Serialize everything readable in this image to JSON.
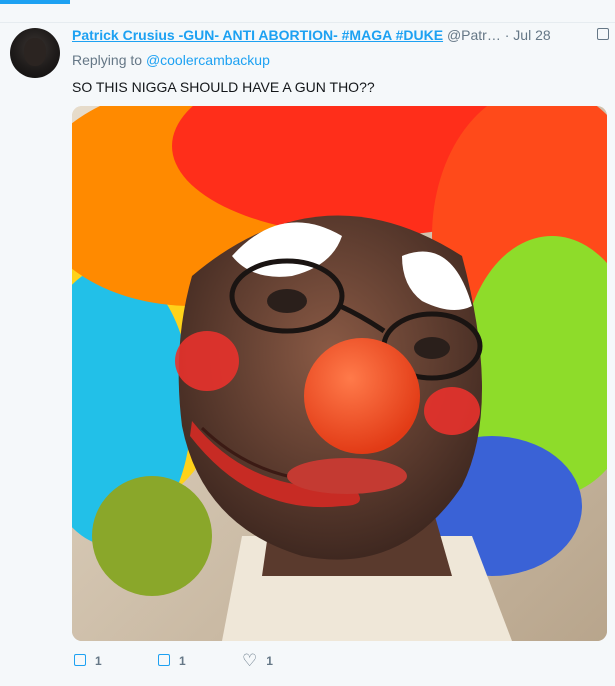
{
  "top_strip": {
    "ghost_text": "                               "
  },
  "tweet": {
    "author_name": "Patrick Crusius -GUN- ANTI ABORTION- #MAGA #DUKE",
    "author_handle": "@Patr…",
    "separator": "·",
    "date": "Jul 28",
    "replying_prefix": "Replying to ",
    "replying_to": "@coolercambackup",
    "text": "SO THIS NIGGA SHOULD HAVE A GUN THO??",
    "icons": {
      "avatar": "user-avatar",
      "caret": "checkbox-icon",
      "reply": "reply-icon",
      "retweet": "retweet-icon",
      "like": "heart-icon"
    },
    "actions": {
      "reply_count": "1",
      "retweet_count": "1",
      "like_count": "1"
    }
  },
  "colors": {
    "link": "#1da1f2",
    "muted": "#657786",
    "background": "#f5f8fa"
  }
}
